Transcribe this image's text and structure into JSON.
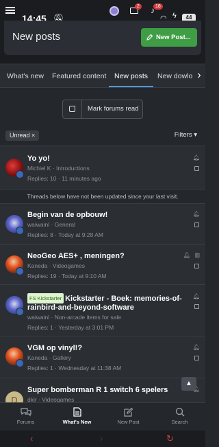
{
  "status": {
    "time": "14:45",
    "mail_badge": "2",
    "notif_badge": "18",
    "battery": "44"
  },
  "header": {
    "title": "New posts",
    "new_post_button": "New Post..."
  },
  "tabs": [
    {
      "label": "What's new"
    },
    {
      "label": "Featured content"
    },
    {
      "label": "New posts",
      "active": true
    },
    {
      "label": "New dowlo"
    }
  ],
  "mark_read": {
    "label": "Mark forums read"
  },
  "filter": {
    "chip": "Unread",
    "chip_close": "×",
    "filters_label": "Filters ▾"
  },
  "notice": "Threads below have not been updated since your last visit.",
  "threads": [
    {
      "title": "Yo yo!",
      "prefix": "",
      "author": "Michiel K",
      "forum": "Introductions",
      "replies": "Replies: 10",
      "time": "11 minutes ago"
    },
    {
      "title": "Begin van de opbouw!",
      "prefix": "",
      "author": "waiwainl",
      "forum": "General",
      "replies": "Replies: 8",
      "time": "Today at 9:28 AM"
    },
    {
      "title": "NeoGeo AES+ , meningen?",
      "prefix": "",
      "author": "Kaneda",
      "forum": "Videogames",
      "replies": "Replies: 19",
      "time": "Today at 9:10 AM"
    },
    {
      "title": "Kickstarter - Boek: memories-of-rainbird-and-beyond-software",
      "prefix": "FS Kickstarter",
      "author": "waiwainl",
      "forum": "Non-arcade items for sale",
      "replies": "Replies: 1",
      "time": "Yesterday at 3:01 PM"
    },
    {
      "title": "VGM op vinyl!?",
      "prefix": "",
      "author": "Kaneda",
      "forum": "Gallery",
      "replies": "Replies: 1",
      "time": "Wednesday at 11:38 AM"
    },
    {
      "title": "Super bomberman R 1 switch 6 spelers",
      "prefix": "",
      "author": "dkir",
      "forum": "Videogames",
      "replies": "",
      "time": ""
    }
  ],
  "avatar_letter": "D",
  "bottom_nav": [
    {
      "label": "Forums"
    },
    {
      "label": "What's New",
      "active": true
    },
    {
      "label": "New Post"
    },
    {
      "label": "Search"
    }
  ],
  "colors": {
    "accent": "#4a9be0",
    "new_post_button": "#3f9d45",
    "background": "#24272c"
  }
}
